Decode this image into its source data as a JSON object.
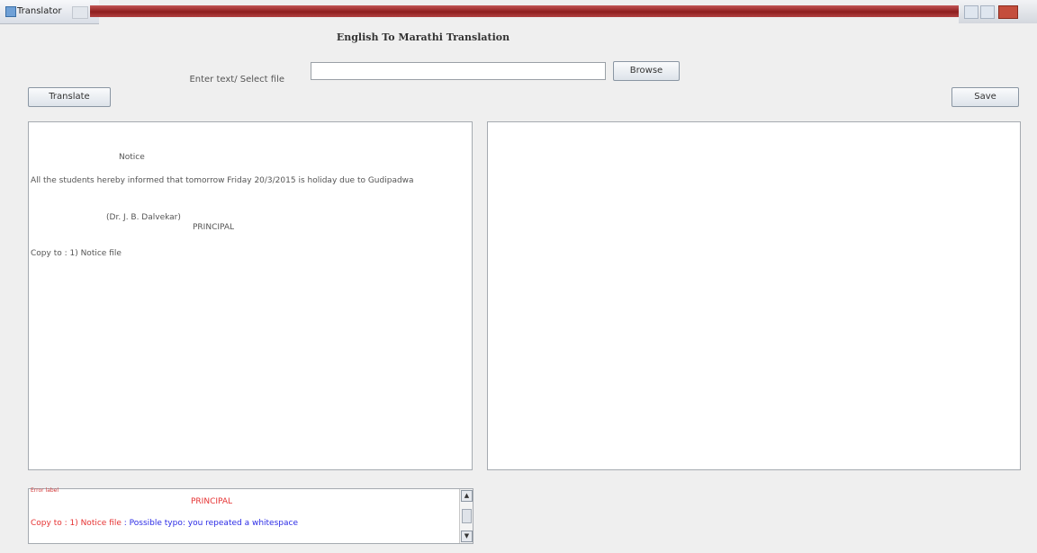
{
  "window": {
    "title": "Translator"
  },
  "heading": "English To Marathi Translation",
  "file_row": {
    "label": "Enter text/ Select file",
    "value": "",
    "browse_label": "Browse"
  },
  "toolbar": {
    "translate_label": "Translate",
    "save_label": "Save"
  },
  "input_text": {
    "notice_title": "Notice",
    "body": "All the students hereby informed that tomorrow Friday 20/3/2015 is holiday due to Gudipadwa",
    "signatory": "(Dr. J. B. Dalvekar)",
    "designation": "PRINCIPAL",
    "copy_to": "Copy to :  1) Notice file"
  },
  "output_text": "",
  "spell_check": {
    "label": "Error label",
    "line1": "PRINCIPAL",
    "line2_prefix": "Copy to :  1) Notice file",
    "line2_message": ": Possible typo: you repeated a whitespace"
  },
  "colors": {
    "error_red": "#e63333",
    "message_blue": "#2b2be6"
  }
}
